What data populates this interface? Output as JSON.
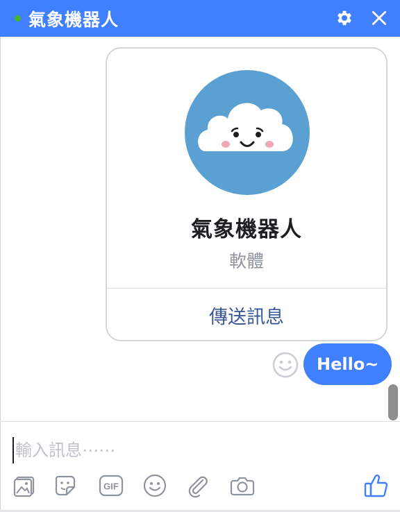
{
  "header": {
    "title": "氣象機器人",
    "status": "online",
    "settings_icon": "gear-icon",
    "close_icon": "close-icon"
  },
  "profile_card": {
    "avatar": "cloud-face-avatar",
    "name": "氣象機器人",
    "category": "軟體",
    "action_label": "傳送訊息"
  },
  "messages": [
    {
      "sender": "me",
      "text": "Hello~"
    }
  ],
  "composer": {
    "placeholder": "輸入訊息⋯⋯",
    "value": ""
  },
  "toolbar": {
    "icons": [
      "image-icon",
      "sticker-icon",
      "gif-icon",
      "emoji-icon",
      "attachment-icon",
      "camera-icon",
      "thumbs-up-icon"
    ],
    "gif_label": "GIF"
  },
  "colors": {
    "brand": "#4080ff",
    "online": "#42b72a",
    "avatar_bg": "#5aa0d2",
    "link": "#3b5998"
  }
}
